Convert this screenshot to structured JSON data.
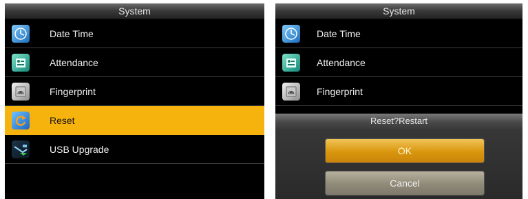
{
  "left_screen": {
    "title": "System",
    "items": [
      {
        "label": "Date Time",
        "icon": "clock-icon",
        "selected": false
      },
      {
        "label": "Attendance",
        "icon": "attendance-icon",
        "selected": false
      },
      {
        "label": "Fingerprint",
        "icon": "fingerprint-icon",
        "selected": false
      },
      {
        "label": "Reset",
        "icon": "reset-icon",
        "selected": true
      },
      {
        "label": "USB Upgrade",
        "icon": "usb-upgrade-icon",
        "selected": false
      }
    ]
  },
  "right_screen": {
    "title": "System",
    "items": [
      {
        "label": "Date Time",
        "icon": "clock-icon"
      },
      {
        "label": "Attendance",
        "icon": "attendance-icon"
      },
      {
        "label": "Fingerprint",
        "icon": "fingerprint-icon"
      }
    ],
    "dialog": {
      "title": "Reset?Restart",
      "ok_label": "OK",
      "cancel_label": "Cancel"
    }
  },
  "colors": {
    "selection": "#f7b30d",
    "ok_button": "#d8960d",
    "cancel_button": "#8f8a78"
  }
}
